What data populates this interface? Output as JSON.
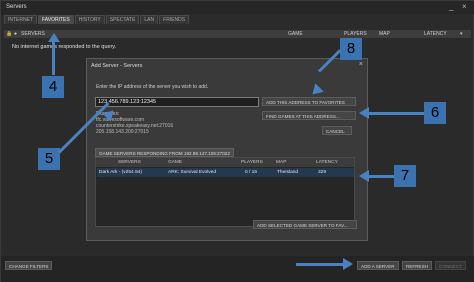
{
  "window": {
    "title": "Servers",
    "minimize": "_",
    "close": "×"
  },
  "tabs": [
    "INTERNET",
    "FAVORITES",
    "HISTORY",
    "SPECTATE",
    "LAN",
    "FRIENDS"
  ],
  "columns": {
    "servers": "SERVERS",
    "game": "GAME",
    "players": "PLAYERS",
    "map": "MAP",
    "latency": "LATENCY"
  },
  "list_message": "No internet games responded to the query.",
  "bottom": {
    "change_filters": "CHANGE FILTERS",
    "add_server": "ADD A SERVER",
    "refresh": "REFRESH",
    "connect": "CONNECT"
  },
  "dialog": {
    "title": "Add Server - Servers",
    "prompt": "Enter the IP address of the server you wish to add.",
    "ip_value": "123.456.789.123:12345",
    "examples_label": "Examples:",
    "examples": [
      "tfc.valvesoftware.com",
      "counterstrike.speakeasy.net:27016",
      "205.158.143.200:27015"
    ],
    "btn_add_favorites": "ADD THIS ADDRESS TO FAVORITES",
    "btn_find_games": "FIND GAMES AT THIS ADDRESS...",
    "btn_cancel": "CANCEL",
    "responding_tab": "GAME SERVERS RESPONDING FROM 192.99.147.109:27022",
    "table_columns": {
      "servers": "SERVERS",
      "game": "GAME",
      "players": "PLAYERS",
      "map": "MAP",
      "latency": "LATENCY"
    },
    "rows": [
      {
        "server": "Dark Ark - (v254.94)",
        "game": "ARK: Survival Evolved",
        "players": "0 / 15",
        "map": "TheIsland",
        "latency": "329"
      }
    ],
    "btn_add_selected": "ADD SELECTED GAME SERVER TO FAV..."
  },
  "markers": [
    "4",
    "8",
    "6",
    "5",
    "7"
  ],
  "colors": {
    "marker_blue": "#3b73b0",
    "selected_row": "#24384f"
  }
}
